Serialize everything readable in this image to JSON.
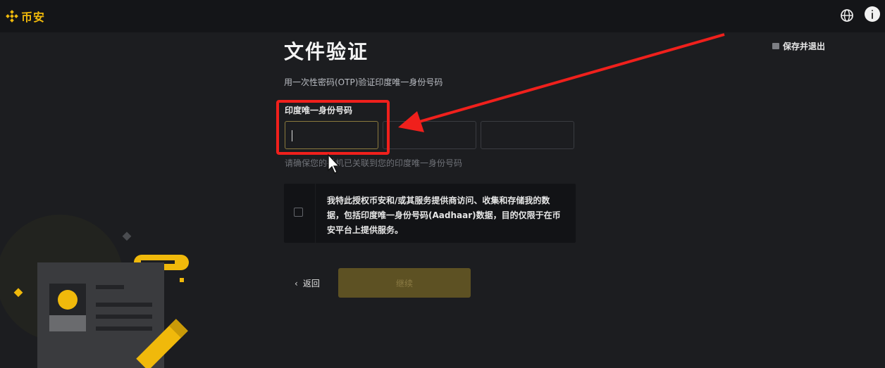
{
  "header": {
    "brand_name": "币安"
  },
  "toolbar": {
    "save_exit_label": "保存并退出"
  },
  "page": {
    "title": "文件验证",
    "subtitle": "用一次性密码(OTP)验证印度唯一身份号码"
  },
  "form": {
    "field_label": "印度唯一身份号码",
    "field_values": [
      "",
      "",
      ""
    ],
    "hint": "请确保您的手机已关联到您的印度唯一身份号码",
    "consent_text": "我特此授权币安和/或其服务提供商访问、收集和存储我的数据，包括印度唯一身份号码(Aadhaar)数据，目的仅限于在币安平台上提供服务。",
    "consent_checked": false
  },
  "actions": {
    "back_label": "返回",
    "continue_label": "继续"
  },
  "colors": {
    "brand": "#f0b90b",
    "background": "#1c1d20",
    "annotation": "#f0201c"
  }
}
